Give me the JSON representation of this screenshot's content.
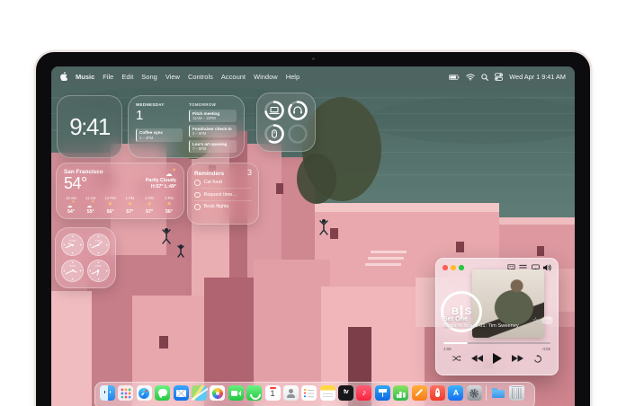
{
  "menu_bar": {
    "items": [
      "Music",
      "File",
      "Edit",
      "Song",
      "View",
      "Controls",
      "Account",
      "Window",
      "Help"
    ],
    "status_icons": [
      "battery-icon",
      "wifi-icon",
      "spotlight-search-icon",
      "control-center-icon"
    ],
    "clock": "Wed Apr 1  9:41 AM"
  },
  "widgets": {
    "clock": {
      "time": "9:41"
    },
    "calendar": {
      "day_name": "WEDNESDAY",
      "day_number": "1",
      "today_events": [
        {
          "title": "Coffee sync",
          "time": "1 – 2PM",
          "icon": "cloud-icon"
        }
      ],
      "tomorrow_label": "TOMORROW",
      "tomorrow_events": [
        {
          "title": "Pitch meeting",
          "time": "11AM – 12PM",
          "icon": "people-icon"
        },
        {
          "title": "Fundraiser check-in",
          "time": "3 – 6PM"
        },
        {
          "title": "Lou's art opening",
          "time": "7 – 8PM"
        }
      ]
    },
    "batteries": {
      "devices": [
        {
          "name": "macbook",
          "level": 72
        },
        {
          "name": "headphones",
          "level": 85
        },
        {
          "name": "mouse",
          "level": 58
        },
        {
          "name": "empty-slot",
          "level": 0
        }
      ]
    },
    "weather": {
      "city": "San Francisco",
      "temperature": "54°",
      "condition": "Partly Cloudy",
      "high": "H:57°",
      "low": "L:49°",
      "hourly": [
        {
          "time": "10 AM",
          "icon": "partly-cloudy",
          "temp": "54°"
        },
        {
          "time": "11 AM",
          "icon": "partly-cloudy",
          "temp": "55°"
        },
        {
          "time": "12 PM",
          "icon": "sunny",
          "temp": "56°"
        },
        {
          "time": "1 PM",
          "icon": "sunny",
          "temp": "57°"
        },
        {
          "time": "2 PM",
          "icon": "sunny",
          "temp": "57°"
        },
        {
          "time": "3 PM",
          "icon": "sunny",
          "temp": "56°"
        }
      ]
    },
    "reminders": {
      "title": "Reminders",
      "count": "3",
      "items": [
        "Cat food",
        "Request time…",
        "Book flights"
      ]
    },
    "world_clock": {
      "cities": [
        "CUP",
        "TOK",
        "SYD",
        "PAR"
      ]
    }
  },
  "music_player": {
    "logo_left": "B",
    "logo_right": "S",
    "track_title": "Set One",
    "track_subtitle": "Beats In Space 01: Tim Sweeney",
    "elapsed": "1:08",
    "remaining": "-4:02",
    "progress_percent": 23,
    "top_icons": [
      "lyrics-icon",
      "queue-icon",
      "airplay-icon",
      "volume-icon"
    ],
    "transport": [
      "shuffle-icon",
      "previous-icon",
      "play-icon",
      "next-icon",
      "repeat-icon"
    ]
  },
  "dock": {
    "apps": [
      "Finder",
      "Launchpad",
      "Safari",
      "Messages",
      "Mail",
      "Maps",
      "Photos",
      "FaceTime",
      "Phone",
      "Calendar",
      "Contacts",
      "Reminders",
      "Notes",
      "TV",
      "Music",
      "Keynote",
      "Numbers",
      "Pages",
      "Rocket",
      "App Store",
      "System Settings",
      "Downloads",
      "Trash"
    ]
  },
  "colors": {
    "sea": "#5f7d76",
    "building_pink": "#dd9ba2",
    "menu_bar": "rgba(82,100,96,0.60)",
    "traffic_red": "#ff5f57",
    "traffic_yellow": "#febc2e",
    "traffic_green": "#28c840"
  }
}
